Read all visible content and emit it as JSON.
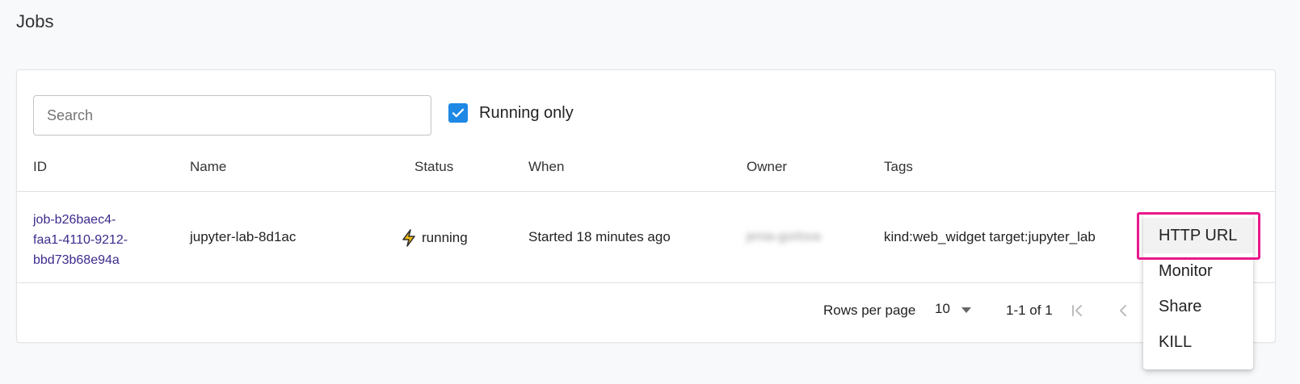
{
  "page": {
    "title": "Jobs"
  },
  "filters": {
    "search_placeholder": "Search",
    "search_value": "",
    "running_only_label": "Running only",
    "running_only_checked": true
  },
  "table": {
    "headers": {
      "id": "ID",
      "name": "Name",
      "status": "Status",
      "when": "When",
      "owner": "Owner",
      "tags": "Tags"
    },
    "rows": [
      {
        "id_lines": [
          "job-b26baec4-",
          "faa1-4110-9212-",
          "bbd73b68e94a"
        ],
        "name": "jupyter-lab-8d1ac",
        "status": "running",
        "status_icon": "lightning-icon",
        "when": "Started 18 minutes ago",
        "owner": "jenia-gorlova",
        "tags": "kind:web_widget target:jupyter_lab"
      }
    ]
  },
  "pagination": {
    "rows_per_page_label": "Rows per page",
    "rows_per_page_value": "10",
    "range": "1-1 of 1"
  },
  "context_menu": {
    "items": [
      "HTTP URL",
      "Monitor",
      "Share",
      "KILL"
    ],
    "highlighted_item": "HTTP URL"
  },
  "colors": {
    "accent": "#1e88e5",
    "link": "#3d2a8c",
    "highlight": "#e8198b",
    "status_icon": "#f2b90c"
  }
}
